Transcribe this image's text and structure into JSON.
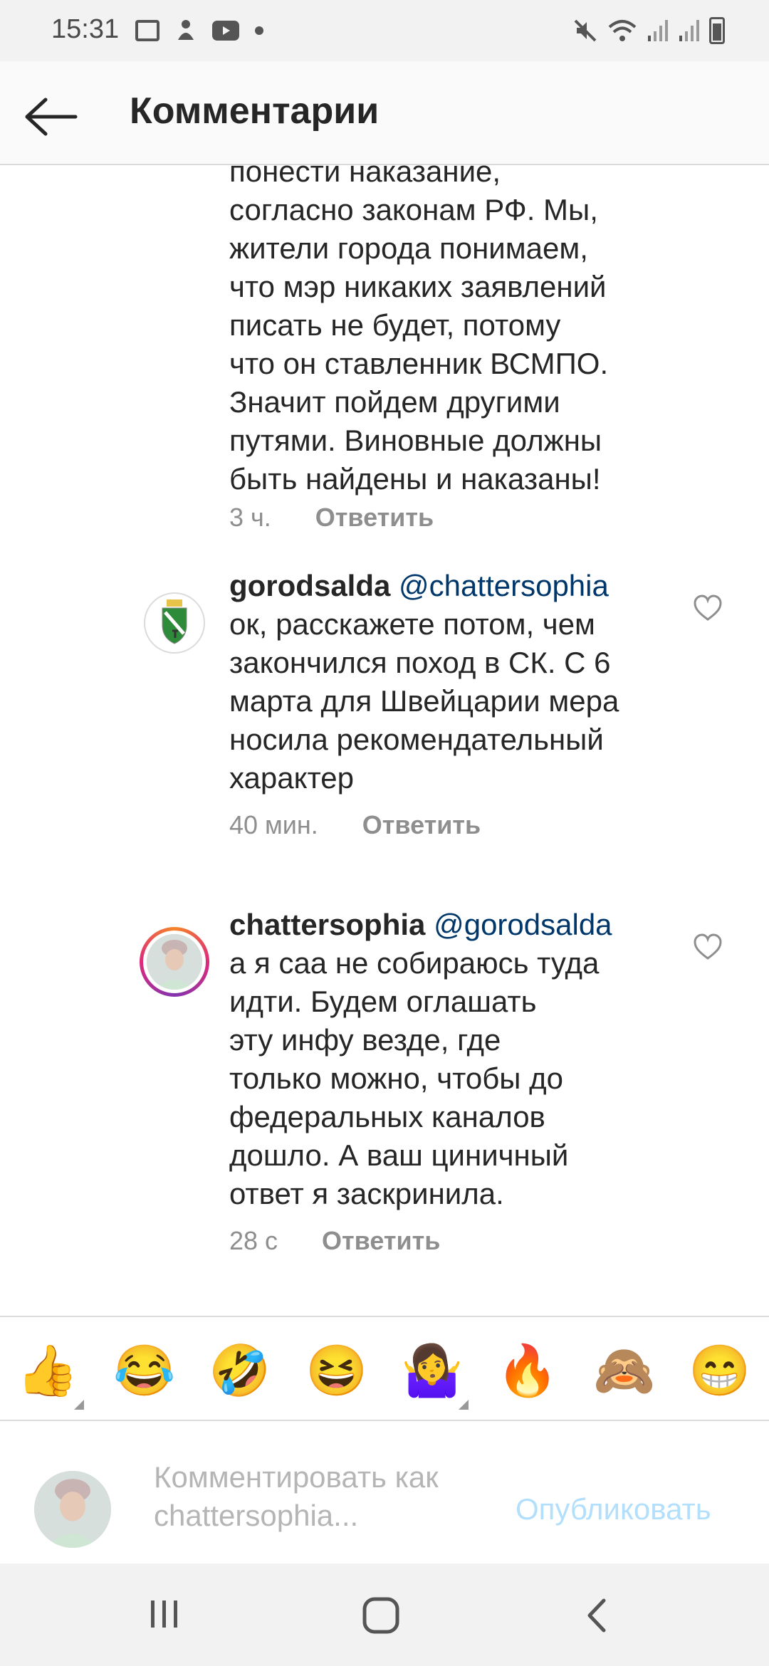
{
  "status_bar": {
    "time": "15:31",
    "left_icons": [
      "image-icon",
      "notification-icon",
      "youtube-icon",
      "dot-icon"
    ],
    "right_icons": [
      "mute-icon",
      "wifi-icon",
      "signal-icon",
      "signal-icon",
      "battery-icon"
    ]
  },
  "header": {
    "title": "Комментарии"
  },
  "comments": [
    {
      "text_lines": [
        "понести наказание,",
        "согласно законам РФ. Мы,",
        "жители города понимаем,",
        "что мэр никаких заявлений",
        "писать не будет, потому",
        "что он ставленник ВСМПО.",
        "Значит пойдем другими",
        "путями. Виновные должны",
        "быть найдены и наказаны!"
      ],
      "time": "3 ч.",
      "reply": "Ответить"
    },
    {
      "username": "gorodsalda",
      "mention": "@chattersophia",
      "text_lines": [
        "ок, расскажете потом, чем",
        "закончился поход в СК. С 6",
        "марта для Швейцарии мера",
        "носила рекомендательный",
        "характер"
      ],
      "time": "40 мин.",
      "reply": "Ответить"
    },
    {
      "username": "chattersophia",
      "mention": "@gorodsalda",
      "text_lines": [
        "а я саа не собираюсь туда",
        "идти. Будем оглашать",
        "эту инфу везде, где",
        "только можно, чтобы до",
        "федеральных каналов",
        "дошло. А ваш циничный",
        "ответ я заскринила."
      ],
      "time": "28 с",
      "reply": "Ответить"
    }
  ],
  "emoji_bar": [
    "👍",
    "😂",
    "🤣",
    "😆",
    "🤷‍♀️",
    "🔥",
    "🙈",
    "😁"
  ],
  "input": {
    "placeholder_line1": "Комментировать как",
    "placeholder_line2": "chattersophia...",
    "publish_label": "Опубликовать"
  },
  "colors": {
    "mention": "#00376b",
    "publish_disabled": "#b2dffc",
    "meta_gray": "#8e8e8e"
  }
}
